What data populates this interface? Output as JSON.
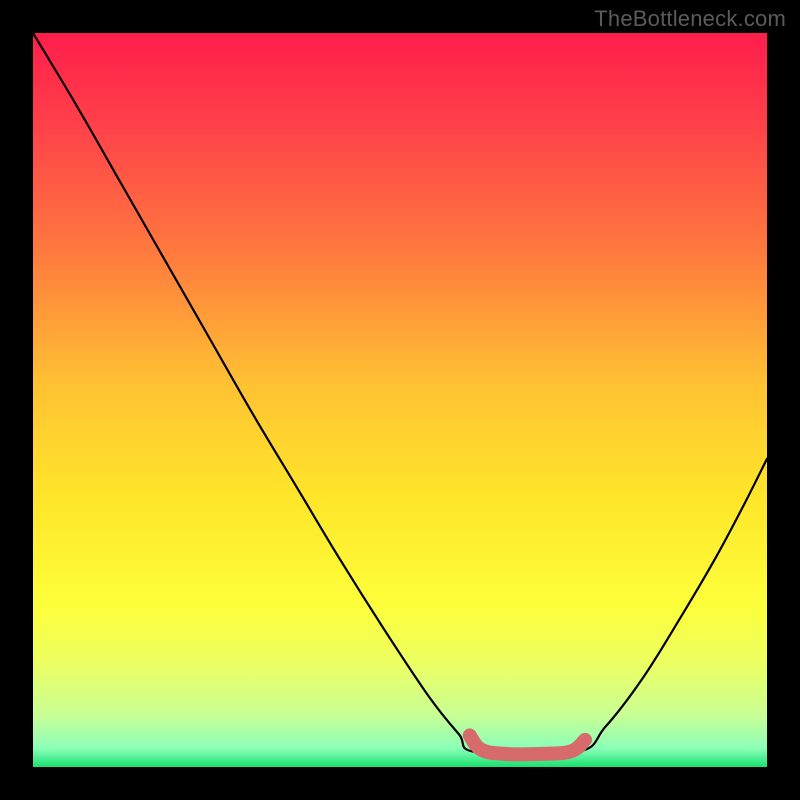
{
  "watermark": "TheBottleneck.com",
  "chart_data": {
    "type": "line",
    "title": "",
    "xlabel": "",
    "ylabel": "",
    "xlim": [
      0,
      1
    ],
    "ylim": [
      0,
      1
    ],
    "gradient_stops": [
      {
        "offset": 0.0,
        "color": "#ff1d4b"
      },
      {
        "offset": 0.12,
        "color": "#ff3f4a"
      },
      {
        "offset": 0.3,
        "color": "#ff7a3e"
      },
      {
        "offset": 0.48,
        "color": "#ffc233"
      },
      {
        "offset": 0.63,
        "color": "#ffe52a"
      },
      {
        "offset": 0.78,
        "color": "#fdff3a"
      },
      {
        "offset": 0.86,
        "color": "#ecff63"
      },
      {
        "offset": 0.93,
        "color": "#c8ff95"
      },
      {
        "offset": 0.975,
        "color": "#8affb8"
      },
      {
        "offset": 1.0,
        "color": "#18e06f"
      }
    ],
    "series": [
      {
        "name": "bottleneck-curve-left",
        "points": [
          {
            "x": 0.0,
            "y": 1.0
          },
          {
            "x": 0.06,
            "y": 0.9
          },
          {
            "x": 0.12,
            "y": 0.795
          },
          {
            "x": 0.18,
            "y": 0.69
          },
          {
            "x": 0.24,
            "y": 0.585
          },
          {
            "x": 0.3,
            "y": 0.48
          },
          {
            "x": 0.36,
            "y": 0.38
          },
          {
            "x": 0.42,
            "y": 0.28
          },
          {
            "x": 0.48,
            "y": 0.185
          },
          {
            "x": 0.54,
            "y": 0.095
          },
          {
            "x": 0.58,
            "y": 0.045
          },
          {
            "x": 0.605,
            "y": 0.02
          }
        ]
      },
      {
        "name": "optimal-flat-segment",
        "points": [
          {
            "x": 0.605,
            "y": 0.02
          },
          {
            "x": 0.74,
            "y": 0.02
          }
        ]
      },
      {
        "name": "bottleneck-curve-right",
        "points": [
          {
            "x": 0.74,
            "y": 0.02
          },
          {
            "x": 0.78,
            "y": 0.055
          },
          {
            "x": 0.83,
            "y": 0.12
          },
          {
            "x": 0.88,
            "y": 0.2
          },
          {
            "x": 0.93,
            "y": 0.285
          },
          {
            "x": 0.97,
            "y": 0.36
          },
          {
            "x": 1.0,
            "y": 0.42
          }
        ]
      }
    ],
    "highlight_segment": {
      "name": "optimal-range-marker",
      "color": "#d76b6b",
      "points": [
        {
          "x": 0.595,
          "y": 0.043
        },
        {
          "x": 0.61,
          "y": 0.024
        },
        {
          "x": 0.64,
          "y": 0.018
        },
        {
          "x": 0.7,
          "y": 0.018
        },
        {
          "x": 0.735,
          "y": 0.022
        },
        {
          "x": 0.752,
          "y": 0.037
        }
      ]
    }
  }
}
